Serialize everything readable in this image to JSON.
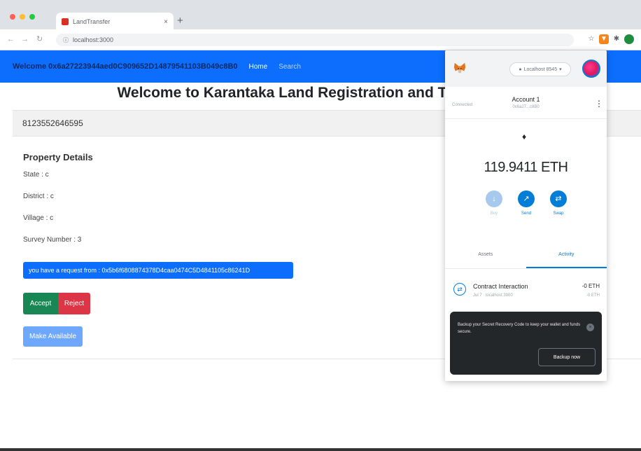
{
  "browser": {
    "tab_title": "LandTransfer",
    "tab_close": "×",
    "new_tab": "+",
    "url": "localhost:3000",
    "colors": {
      "close": "#ff5f57",
      "minimize": "#febc2e",
      "maximize": "#28c840"
    }
  },
  "navbar": {
    "brand": "Welcome 0x6a27223944aed0C909652D14879541103B049c8B0",
    "links": [
      "Home",
      "Search"
    ]
  },
  "page": {
    "title": "Welcome to Karantaka Land Registration and Transfer",
    "id_number": "8123552646595"
  },
  "property": {
    "heading": "Property Details",
    "state": "State : c",
    "district": "District : c",
    "village": "Village : c",
    "survey": "Survey Number : 3"
  },
  "request": {
    "text": "you have a request from : 0x5b6f6808874378D4caa0474C5D4841105c86241D"
  },
  "buttons": {
    "accept": "Accept",
    "reject": "Reject",
    "make_available": "Make Available"
  },
  "metamask": {
    "network": "Localhost 8545",
    "connected": "Connected",
    "account_name": "Account 1",
    "account_address": "0x6a27...c8B0",
    "kebab": "⋮",
    "balance": "119.9411 ETH",
    "actions": [
      {
        "label": "Buy",
        "icon": "↓",
        "enabled": false
      },
      {
        "label": "Send",
        "icon": "↗",
        "enabled": true
      },
      {
        "label": "Swap",
        "icon": "⇄",
        "enabled": true
      }
    ],
    "tabs": [
      "Assets",
      "Activity"
    ],
    "active_tab": "Activity",
    "transaction": {
      "title": "Contract Interaction",
      "subtitle": "Jul 7 · localhost:3000",
      "amount": "-0 ETH",
      "amount_secondary": "-0 ETH"
    },
    "toast": {
      "text": "Backup your Secret Recovery Code to keep your wallet and funds secure.",
      "button": "Backup now",
      "close": "×"
    }
  }
}
